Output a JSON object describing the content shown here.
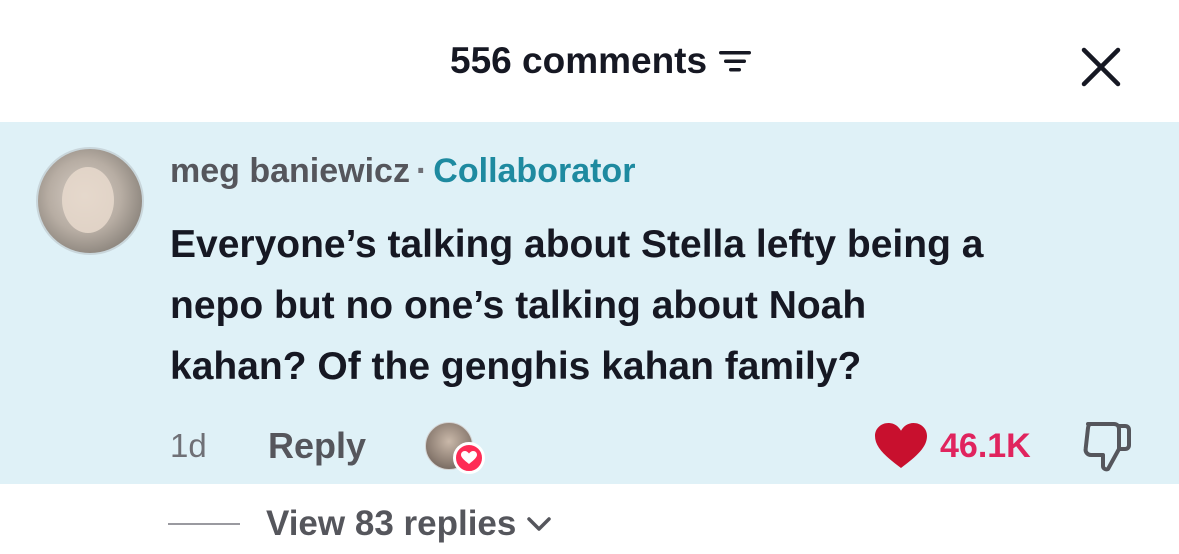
{
  "header": {
    "comment_count_label": "556 comments"
  },
  "comment": {
    "author": "meg baniewicz",
    "separator": "·",
    "badge": "Collaborator",
    "text": "Everyone’s talking about Stella lefty being a\nnepo but no one’s talking about Noah\nkahan? Of the genghis kahan family?",
    "time": "1d",
    "reply_label": "Reply",
    "like_count": "46.1K"
  },
  "replies": {
    "view_label": "View 83 replies"
  },
  "colors": {
    "highlight_bg": "#dff1f7",
    "badge": "#1e8aa0",
    "like_red": "#e0245e",
    "heart_red": "#c8102e"
  },
  "icons": {
    "sort": "sort-lines-icon",
    "close": "close-icon",
    "like": "heart-icon",
    "dislike": "thumbs-down-icon",
    "expand": "chevron-down-icon"
  }
}
